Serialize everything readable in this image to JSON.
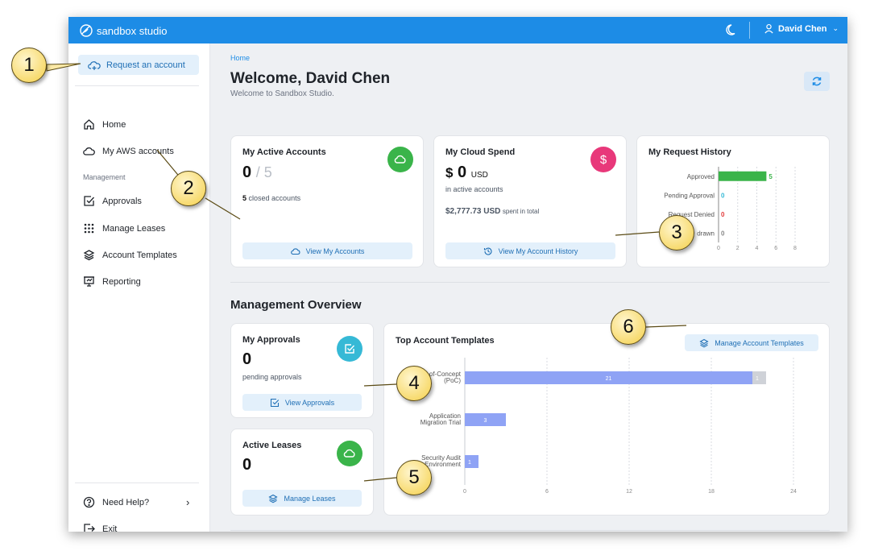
{
  "colors": {
    "brand": "#1d8ce6",
    "green": "#3ab44a",
    "pink": "#e8387a",
    "teal": "#36b9d6",
    "red": "#e23b3b",
    "bar_blue": "#8fa3f5",
    "bar_grey": "#cfd2d8"
  },
  "topbar": {
    "brand_name": "sandbox studio",
    "user_name": "David Chen"
  },
  "sidebar": {
    "request_label": "Request an account",
    "items": [
      {
        "label": "Home",
        "icon": "home-icon"
      },
      {
        "label": "My AWS accounts",
        "icon": "cloud-icon"
      }
    ],
    "management_heading": "Management",
    "management_items": [
      {
        "label": "Approvals",
        "icon": "checkbox-icon"
      },
      {
        "label": "Manage Leases",
        "icon": "grid-dots-icon"
      },
      {
        "label": "Account Templates",
        "icon": "layers-icon"
      },
      {
        "label": "Reporting",
        "icon": "presentation-icon"
      }
    ],
    "help_label": "Need Help?",
    "exit_label": "Exit"
  },
  "main": {
    "breadcrumb": "Home",
    "title": "Welcome, David Chen",
    "subtitle": "Welcome to Sandbox Studio."
  },
  "active_accounts": {
    "title": "My Active Accounts",
    "active": "0",
    "total": "/ 5",
    "closed_count": "5",
    "closed_label": "closed accounts",
    "button": "View My Accounts"
  },
  "cloud_spend": {
    "title": "My Cloud Spend",
    "currency_symbol": "$",
    "amount": "0",
    "currency": "USD",
    "note": "in active accounts",
    "total_amount": "$2,777.73 USD",
    "total_label": "spent in total",
    "button": "View My Account History"
  },
  "request_history": {
    "title": "My Request History",
    "chart_data": {
      "type": "bar",
      "orientation": "horizontal",
      "categories": [
        "Approved",
        "Pending Approval",
        "Request Denied",
        "Withdrawn"
      ],
      "category_labels_visible": [
        "Approved",
        "Pending Approval",
        "Request Denied",
        "drawn"
      ],
      "values": [
        5,
        0,
        0,
        0
      ],
      "value_label_colors": [
        "#3ab44a",
        "#36b9d6",
        "#e23b3b",
        "#888888"
      ],
      "bar_color": "#3ab44a",
      "xlim": [
        0,
        8
      ],
      "x_ticks": [
        "0",
        "2",
        "4",
        "6",
        "8"
      ],
      "grid": true
    }
  },
  "management": {
    "title": "Management Overview",
    "approvals": {
      "title": "My Approvals",
      "count": "0",
      "label": "pending approvals",
      "button": "View Approvals"
    },
    "leases": {
      "title": "Active Leases",
      "count": "0",
      "button": "Manage Leases"
    }
  },
  "top_templates": {
    "title": "Top Account Templates",
    "button": "Manage Account Templates",
    "chart_data": {
      "type": "bar",
      "orientation": "horizontal",
      "stacked": true,
      "categories": [
        [
          "Proof-of-Concept",
          "(PoC)"
        ],
        [
          "Application",
          "Migration Trial"
        ],
        [
          "Security Audit",
          "Environment"
        ]
      ],
      "series": [
        {
          "values": [
            21,
            3,
            1
          ],
          "color": "#8fa3f5"
        },
        {
          "values": [
            1,
            0,
            0
          ],
          "color": "#cfd2d8"
        }
      ],
      "xlim": [
        0,
        24
      ],
      "x_ticks": [
        "0",
        "6",
        "12",
        "18",
        "24"
      ],
      "grid": true
    }
  },
  "callouts": [
    "1",
    "2",
    "3",
    "4",
    "5",
    "6"
  ]
}
